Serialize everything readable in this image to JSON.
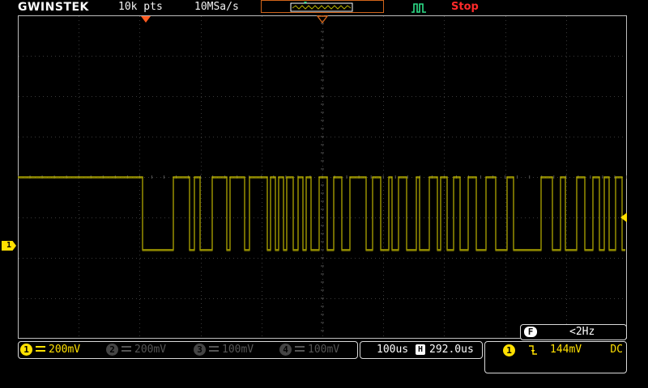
{
  "header": {
    "brand": "GWINSTEK",
    "record_length": "10k pts",
    "sample_rate": "10MSa/s",
    "run_state": "Stop"
  },
  "colors": {
    "ch1": "#ffe000",
    "trace": "#b8b000",
    "stop": "#ff2a2a",
    "trigger_marker": "#ff5a1f",
    "grid": "#3a3a3a"
  },
  "channels": [
    {
      "num": "1",
      "coupling_icon": "dc-coupling-icon",
      "scale": "200mV",
      "active": true
    },
    {
      "num": "2",
      "coupling_icon": "dc-coupling-icon",
      "scale": "200mV",
      "active": false
    },
    {
      "num": "3",
      "coupling_icon": "dc-coupling-icon",
      "scale": "100mV",
      "active": false
    },
    {
      "num": "4",
      "coupling_icon": "dc-coupling-icon",
      "scale": "100mV",
      "active": false
    }
  ],
  "timebase": {
    "scale": "100us",
    "position": "292.0us"
  },
  "frequency": {
    "badge": "F",
    "value": "<2Hz"
  },
  "trigger": {
    "source": "1",
    "slope_icon": "falling-edge-icon",
    "level": "144mV",
    "coupling": "DC"
  },
  "ch1_marker": "1"
}
